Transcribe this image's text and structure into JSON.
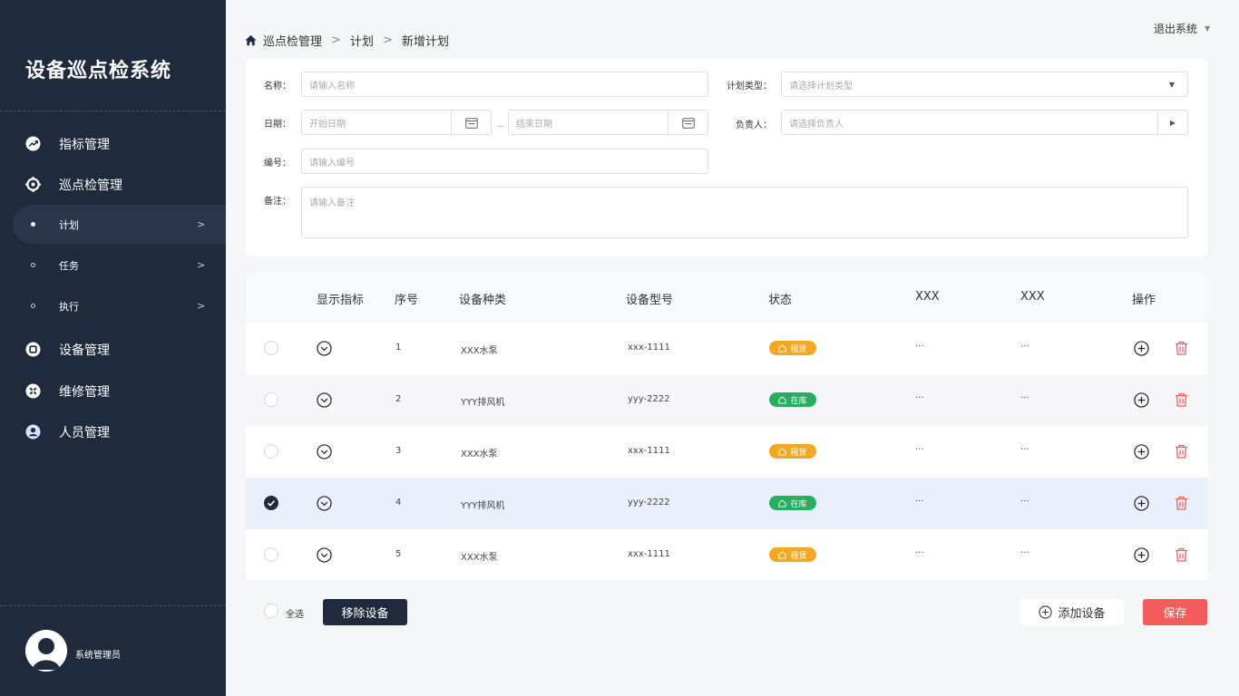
{
  "app": {
    "title": "设备巡点检系统"
  },
  "sidebar": {
    "nav": [
      {
        "label": "指标管理",
        "icon": "trend-icon"
      },
      {
        "label": "巡点检管理",
        "icon": "target-icon"
      },
      {
        "label": "设备管理",
        "icon": "device-icon"
      },
      {
        "label": "维修管理",
        "icon": "tools-icon"
      },
      {
        "label": "人员管理",
        "icon": "person-icon"
      }
    ],
    "subnav": [
      {
        "label": "计划",
        "chevron": ">",
        "active": true
      },
      {
        "label": "任务",
        "chevron": ">",
        "active": false
      },
      {
        "label": "执行",
        "chevron": ">",
        "active": false
      }
    ],
    "user": {
      "name": "系统管理员"
    }
  },
  "header": {
    "breadcrumb": [
      "巡点检管理",
      "计划",
      "新增计划"
    ],
    "separator": ">",
    "logout": "退出系统"
  },
  "form": {
    "name": {
      "label": "名称：",
      "placeholder": "请输入名称"
    },
    "plan_type": {
      "label": "计划类型：",
      "placeholder": "请选择计划类型"
    },
    "date": {
      "label": "日期：",
      "start_placeholder": "开始日期",
      "end_placeholder": "结束日期",
      "dash": "—"
    },
    "owner": {
      "label": "负责人：",
      "placeholder": "请选择负责人"
    },
    "code": {
      "label": "编号：",
      "placeholder": "请输入编号"
    },
    "remark": {
      "label": "备注：",
      "placeholder": "请输入备注"
    }
  },
  "table": {
    "columns": [
      "显示指标",
      "序号",
      "设备种类",
      "设备型号",
      "状态",
      "XXX",
      "XXX",
      "操作"
    ],
    "rows": [
      {
        "index": "1",
        "kind": "XXX水泵",
        "model": "xxx-1111",
        "status": "租赁",
        "x1": "···",
        "x2": "···",
        "checked": false
      },
      {
        "index": "2",
        "kind": "YYY排风机",
        "model": "yyy-2222",
        "status": "在库",
        "x1": "···",
        "x2": "···",
        "checked": false
      },
      {
        "index": "3",
        "kind": "XXX水泵",
        "model": "xxx-1111",
        "status": "租赁",
        "x1": "···",
        "x2": "···",
        "checked": false
      },
      {
        "index": "4",
        "kind": "YYY排风机",
        "model": "yyy-2222",
        "status": "在库",
        "x1": "···",
        "x2": "···",
        "checked": true
      },
      {
        "index": "5",
        "kind": "XXX水泵",
        "model": "xxx-1111",
        "status": "租赁",
        "x1": "···",
        "x2": "···",
        "checked": false
      }
    ]
  },
  "footer": {
    "select_all": "全选",
    "remove_button": "移除设备",
    "add_button": "添加设备",
    "save_button": "保存"
  },
  "colors": {
    "sidebar_bg": "#1f2a3d",
    "rent_badge": "#f5a623",
    "stock_badge": "#27ae60",
    "danger": "#f25c5c",
    "selected_row": "#e9f0fb"
  }
}
